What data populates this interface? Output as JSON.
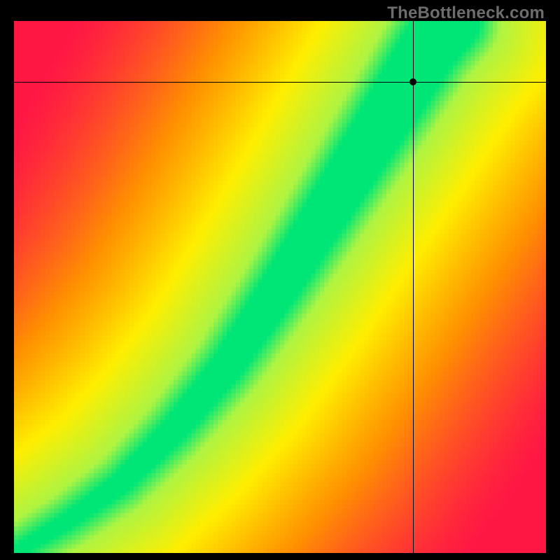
{
  "watermark": "TheBottleneck.com",
  "chart_data": {
    "type": "heatmap",
    "title": "",
    "xlabel": "",
    "ylabel": "",
    "xlim": [
      0,
      1
    ],
    "ylim": [
      0,
      1
    ],
    "grid": false,
    "legend": false,
    "description": "Normalized bottleneck compatibility heatmap. The x-axis (left→right, 0→1) and y-axis (bottom→top, 0→1) represent normalized performance of two components. Color at each (x, y) encodes balance: green = well-matched (~0% bottleneck), yellow/orange = moderate mismatch, red = severe bottleneck. The optimal-match ridge follows a slightly super-linear curve from the origin toward the top-right. Crosshair marks the user's selected component pair.",
    "colorscale": [
      {
        "stop": 0.0,
        "color": "#ff1744",
        "meaning": "severe-bottleneck"
      },
      {
        "stop": 0.35,
        "color": "#ff9100",
        "meaning": "high-bottleneck"
      },
      {
        "stop": 0.65,
        "color": "#ffee00",
        "meaning": "moderate"
      },
      {
        "stop": 0.9,
        "color": "#aef442",
        "meaning": "near-balanced"
      },
      {
        "stop": 1.0,
        "color": "#00e676",
        "meaning": "balanced"
      }
    ],
    "optimal_curve": {
      "comment": "Sampled (x, y) points along the green centerline, normalized 0..1, origin at bottom-left.",
      "points": [
        [
          0.0,
          0.0
        ],
        [
          0.1,
          0.06
        ],
        [
          0.2,
          0.13
        ],
        [
          0.3,
          0.23
        ],
        [
          0.4,
          0.35
        ],
        [
          0.5,
          0.5
        ],
        [
          0.6,
          0.66
        ],
        [
          0.7,
          0.82
        ],
        [
          0.78,
          0.95
        ],
        [
          0.82,
          1.0
        ]
      ],
      "band_halfwidth_start": 0.01,
      "band_halfwidth_end": 0.06
    },
    "crosshair": {
      "x": 0.75,
      "y": 0.885
    },
    "resolution": 120
  }
}
